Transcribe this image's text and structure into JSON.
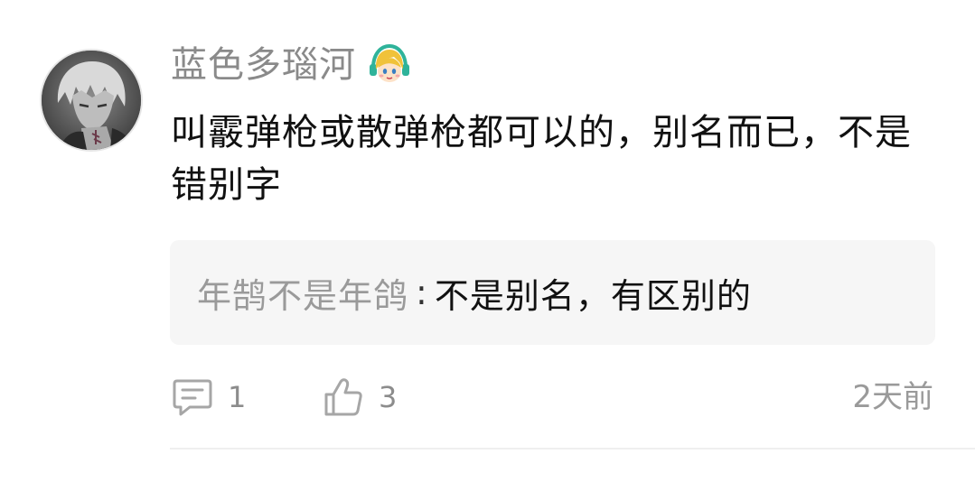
{
  "comment": {
    "username": "蓝色多瑙河",
    "badge_icon": "cartoon-girl-badge-icon",
    "text": "叫霰弹枪或散弹枪都可以的，别名而已，不是错别字",
    "reply": {
      "author": "年鹄不是年鸽",
      "separator": ":",
      "text": "不是别名，有区别的"
    },
    "reply_count": "1",
    "like_count": "3",
    "time_ago": "2天前"
  },
  "colors": {
    "username": "#8a8a8a",
    "text": "#111111",
    "reply_background": "#f6f6f6",
    "muted": "#9a9a9a"
  }
}
